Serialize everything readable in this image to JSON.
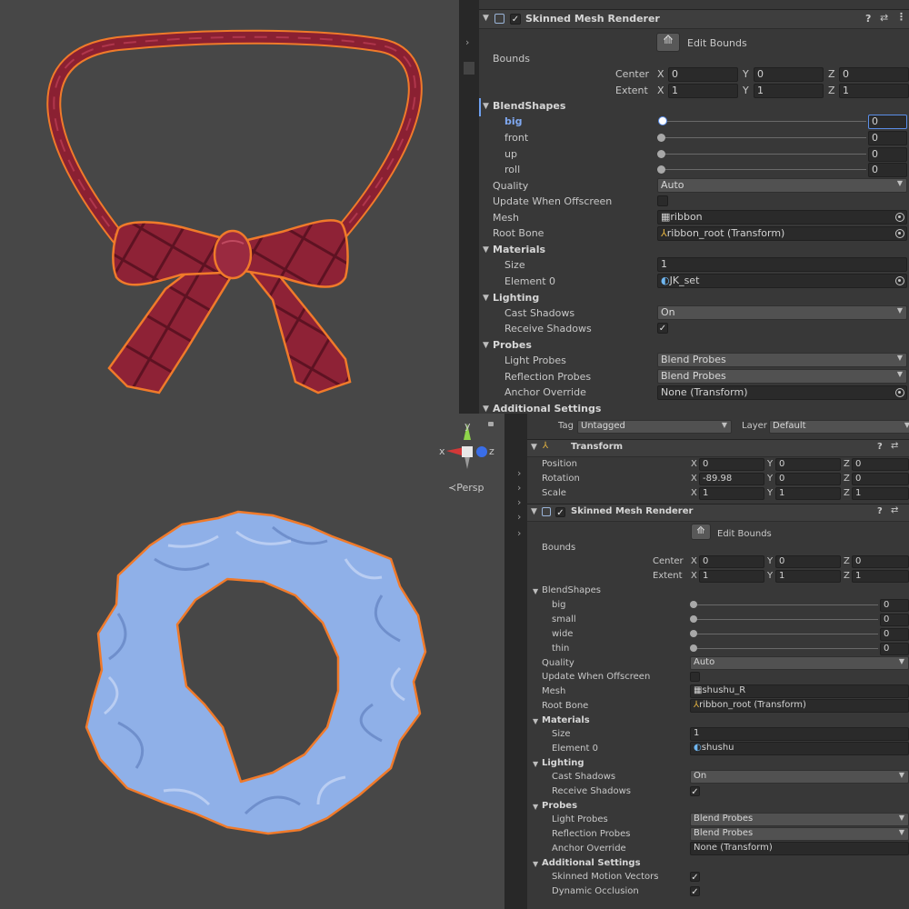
{
  "header_icons": [
    "component-icon",
    "check-icon",
    "help-icon",
    "settings-icon",
    "more-icon"
  ],
  "inspector_top": {
    "component_title": "Skinned Mesh Renderer",
    "edit_bounds": "Edit Bounds",
    "bounds_label": "Bounds",
    "center_label": "Center",
    "extent_label": "Extent",
    "axes": [
      "X",
      "Y",
      "Z"
    ],
    "center": [
      "0",
      "0",
      "0"
    ],
    "extent": [
      "1",
      "1",
      "1"
    ],
    "blendshapes_label": "BlendShapes",
    "blendshapes": [
      {
        "name": "big",
        "value": "0"
      },
      {
        "name": "front",
        "value": "0"
      },
      {
        "name": "up",
        "value": "0"
      },
      {
        "name": "roll",
        "value": "0"
      }
    ],
    "quality_label": "Quality",
    "quality_value": "Auto",
    "update_offscreen_label": "Update When Offscreen",
    "mesh_label": "Mesh",
    "mesh_value": "ribbon",
    "root_bone_label": "Root Bone",
    "root_bone_value": "ribbon_root (Transform)",
    "materials_label": "Materials",
    "size_label": "Size",
    "size_value": "1",
    "element0_label": "Element 0",
    "element0_value": "JK_set",
    "lighting_label": "Lighting",
    "cast_shadows_label": "Cast Shadows",
    "cast_shadows_value": "On",
    "receive_shadows_label": "Receive Shadows",
    "probes_label": "Probes",
    "light_probes_label": "Light Probes",
    "light_probes_value": "Blend Probes",
    "reflection_probes_label": "Reflection Probes",
    "reflection_probes_value": "Blend Probes",
    "anchor_override_label": "Anchor Override",
    "anchor_override_value": "None (Transform)",
    "additional_settings_label": "Additional Settings"
  },
  "gizmo": {
    "x": "x",
    "y": "y",
    "z": "z",
    "persp": "Persp"
  },
  "inspector_bottom": {
    "tag_label": "Tag",
    "tag_value": "Untagged",
    "layer_label": "Layer",
    "layer_value": "Default",
    "transform_title": "Transform",
    "position_label": "Position",
    "rotation_label": "Rotation",
    "scale_label": "Scale",
    "axes": [
      "X",
      "Y",
      "Z"
    ],
    "position": [
      "0",
      "0",
      "0"
    ],
    "rotation": [
      "-89.98",
      "0",
      "0"
    ],
    "scale": [
      "1",
      "1",
      "1"
    ],
    "component_title": "Skinned Mesh Renderer",
    "edit_bounds": "Edit Bounds",
    "bounds_label": "Bounds",
    "center_label": "Center",
    "extent_label": "Extent",
    "center": [
      "0",
      "0",
      "0"
    ],
    "extent": [
      "1",
      "1",
      "1"
    ],
    "blendshapes_label": "BlendShapes",
    "blendshapes": [
      {
        "name": "big",
        "value": "0"
      },
      {
        "name": "small",
        "value": "0"
      },
      {
        "name": "wide",
        "value": "0"
      },
      {
        "name": "thin",
        "value": "0"
      }
    ],
    "quality_label": "Quality",
    "quality_value": "Auto",
    "update_offscreen_label": "Update When Offscreen",
    "mesh_label": "Mesh",
    "mesh_value": "shushu_R",
    "root_bone_label": "Root Bone",
    "root_bone_value": "ribbon_root (Transform)",
    "materials_label": "Materials",
    "size_label": "Size",
    "size_value": "1",
    "element0_label": "Element 0",
    "element0_value": "shushu",
    "lighting_label": "Lighting",
    "cast_shadows_label": "Cast Shadows",
    "cast_shadows_value": "On",
    "receive_shadows_label": "Receive Shadows",
    "probes_label": "Probes",
    "light_probes_label": "Light Probes",
    "light_probes_value": "Blend Probes",
    "reflection_probes_label": "Reflection Probes",
    "reflection_probes_value": "Blend Probes",
    "anchor_override_label": "Anchor Override",
    "anchor_override_value": "None (Transform)",
    "additional_settings_label": "Additional Settings",
    "skinned_motion_label": "Skinned Motion Vectors",
    "dynamic_occlusion_label": "Dynamic Occlusion"
  },
  "colors": {
    "ribbon": "#8e2236",
    "outline": "#f07a2a",
    "scrunchie": "#8fb0e8",
    "panel": "#383838",
    "viewport": "#474747",
    "accent": "#6ea0f0"
  }
}
